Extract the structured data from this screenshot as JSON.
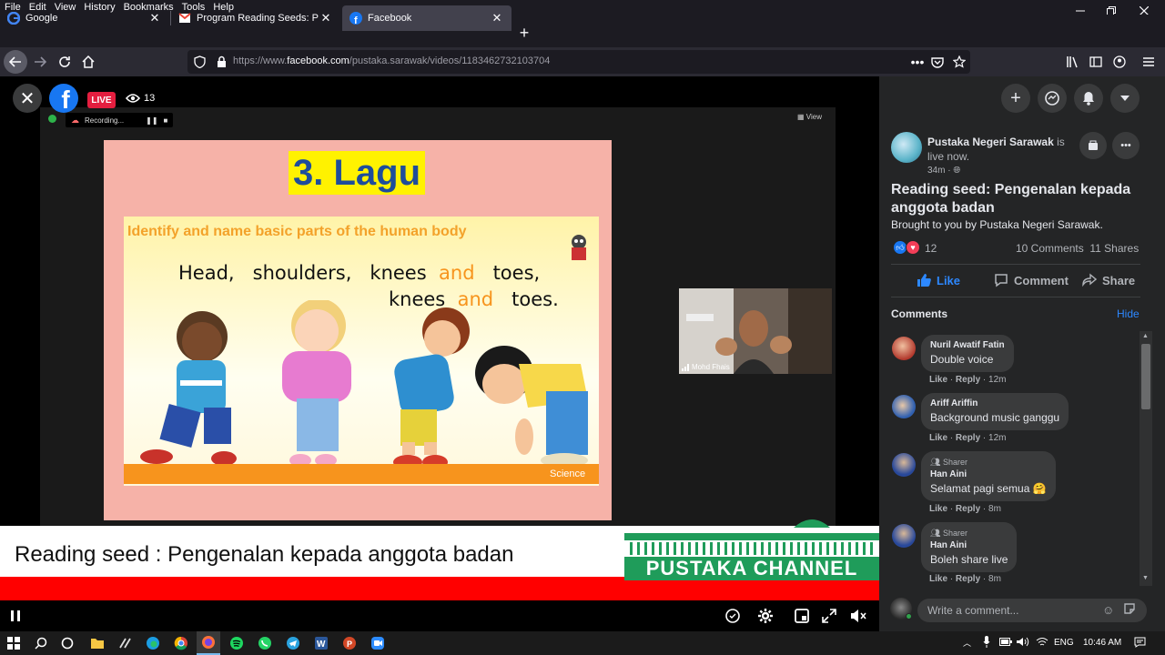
{
  "menubar": {
    "items": [
      "File",
      "Edit",
      "View",
      "History",
      "Bookmarks",
      "Tools",
      "Help"
    ]
  },
  "tabs": [
    {
      "label": "Google",
      "icon": "google-favicon"
    },
    {
      "label": "Program Reading Seeds: Penge",
      "icon": "gmail-favicon"
    },
    {
      "label": "Facebook",
      "icon": "facebook-favicon"
    }
  ],
  "address": {
    "prefix": "https://www.",
    "domain": "facebook.com",
    "path": "/pustaka.sarawak/videos/1183462732103704"
  },
  "video": {
    "live_label": "LIVE",
    "viewer_count": "13",
    "recording_label": "Recording...",
    "view_label": "View",
    "slide": {
      "heading": "3. Lagu",
      "panel_title": "Identify and name basic parts of the human body",
      "line1": {
        "w1": "Head,",
        "w2": "shoulders,",
        "w3": "knees",
        "and": "and",
        "w4": "toes,"
      },
      "line2": {
        "w1": "knees",
        "and": "and",
        "w2": "toes."
      },
      "footer": "Science"
    },
    "webcam_name": "Mohd Fhais",
    "lower_third": "Reading seed : Pengenalan kepada anggota badan",
    "banner": "PUSTAKA CHANNEL"
  },
  "post": {
    "page_name": "Pustaka Negeri Sarawak",
    "status": "is live now.",
    "time": "34m",
    "title": "Reading seed: Pengenalan kepada anggota badan",
    "subtitle": "Brought to you by Pustaka Negeri Sarawak.",
    "reactions": "12",
    "comments_count": "10 Comments",
    "shares_count": "11 Shares",
    "actions": {
      "like": "Like",
      "comment": "Comment",
      "share": "Share"
    },
    "comments_header": "Comments",
    "hide_label": "Hide"
  },
  "comments": [
    {
      "name": "Nuril Awatif Fatin",
      "text": "Double voice",
      "badge": "",
      "like": "Like",
      "reply": "Reply",
      "time": "12m"
    },
    {
      "name": "Ariff Ariffin",
      "text": "Background music ganggu",
      "badge": "",
      "like": "Like",
      "reply": "Reply",
      "time": "12m"
    },
    {
      "name": "Han Aini",
      "text": "Selamat pagi semua 🤗",
      "badge": "Sharer",
      "like": "Like",
      "reply": "Reply",
      "time": "8m"
    },
    {
      "name": "Han Aini",
      "text": "Boleh share live",
      "badge": "Sharer",
      "like": "Like",
      "reply": "Reply",
      "time": "8m"
    }
  ],
  "write_comment": {
    "placeholder": "Write a comment..."
  },
  "taskbar": {
    "lang": "ENG",
    "time": "10:46 AM"
  }
}
